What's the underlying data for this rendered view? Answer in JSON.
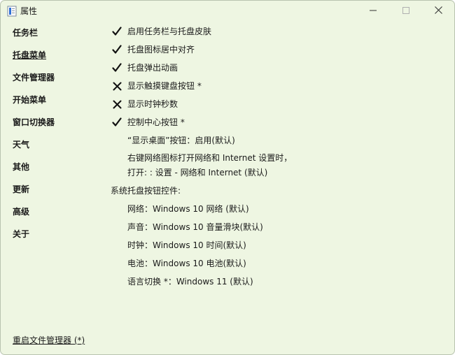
{
  "window": {
    "title": "属性",
    "minimize_label": "minimize",
    "maximize_label": "maximize",
    "close_label": "close"
  },
  "sidebar": {
    "items": [
      {
        "label": "任务栏",
        "active": false
      },
      {
        "label": "托盘菜单",
        "active": true
      },
      {
        "label": "文件管理器",
        "active": false
      },
      {
        "label": "开始菜单",
        "active": false
      },
      {
        "label": "窗口切换器",
        "active": false
      },
      {
        "label": "天气",
        "active": false
      },
      {
        "label": "其他",
        "active": false
      },
      {
        "label": "更新",
        "active": false
      },
      {
        "label": "高级",
        "active": false
      },
      {
        "label": "关于",
        "active": false
      }
    ]
  },
  "options": [
    {
      "label": "启用任务栏与托盘皮肤",
      "state": "check-icon"
    },
    {
      "label": "托盘图标居中对齐",
      "state": "check-icon"
    },
    {
      "label": "托盘弹出动画",
      "state": "check-icon"
    },
    {
      "label": "显示触摸键盘按钮 *",
      "state": "cross-icon"
    },
    {
      "label": "显示时钟秒数",
      "state": "cross-icon"
    },
    {
      "label": "控制中心按钮 *",
      "state": "check-icon"
    }
  ],
  "show_desktop": "“显示桌面”按钮：启用(默认)",
  "network_right_click": {
    "line1": "右键网络图标打开网络和 Internet 设置时，",
    "line2": "打开: : 设置 - 网络和 Internet (默认)"
  },
  "tray_controls": {
    "heading": "系统托盘按钮控件:",
    "items": [
      "网络：Windows 10 网络 (默认)",
      "声音：Windows 10 音量滑块(默认)",
      "时钟：Windows 10 时间(默认)",
      "电池：Windows 10 电池(默认)",
      "语言切换 *：Windows 11 (默认)"
    ]
  },
  "footer": {
    "restart_label": "重启文件管理器 (*)"
  }
}
